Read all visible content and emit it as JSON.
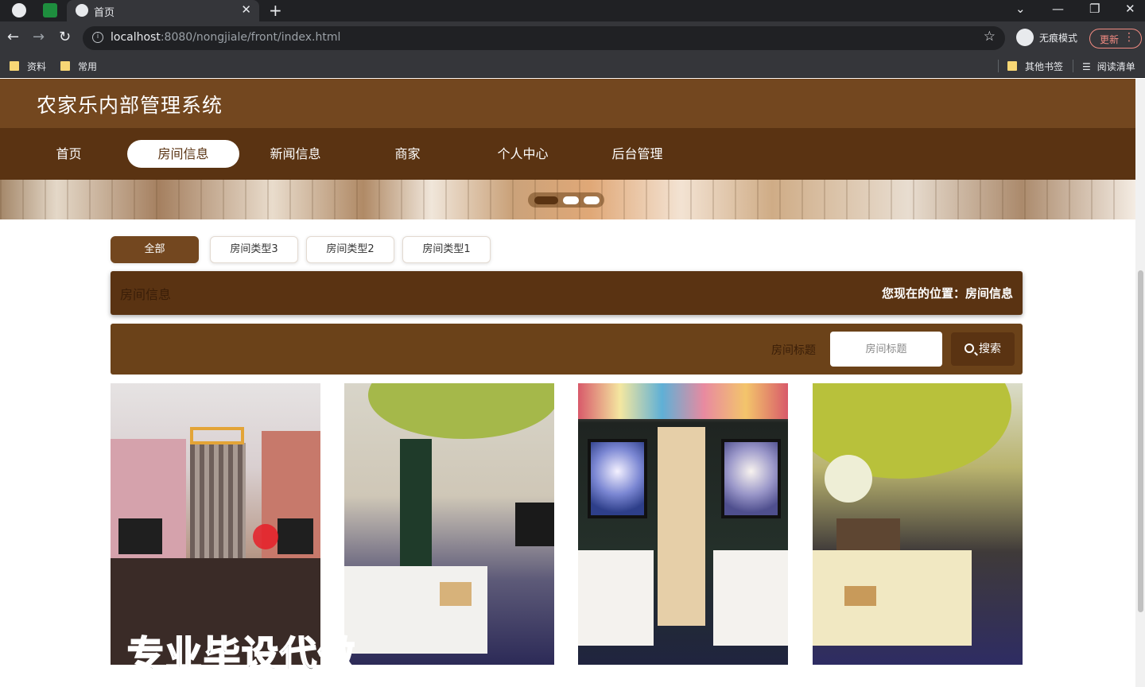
{
  "browser": {
    "tab_title": "首页",
    "url_host": "localhost",
    "url_rest": ":8080/nongjiale/front/index.html",
    "incognito_label": "无痕模式",
    "update_label": "更新",
    "bookmarks": [
      "资料",
      "常用"
    ],
    "bookmarks_right": [
      "其他书签",
      "阅读清单"
    ]
  },
  "site": {
    "title": "农家乐内部管理系统",
    "nav": [
      "首页",
      "房间信息",
      "新闻信息",
      "商家",
      "个人中心",
      "后台管理"
    ],
    "nav_active_index": 1
  },
  "filters": {
    "items": [
      "全部",
      "房间类型3",
      "房间类型2",
      "房间类型1"
    ],
    "active_index": 0
  },
  "crumb": {
    "title": "房间信息",
    "location": "您现在的位置：房间信息"
  },
  "search": {
    "label": "房间标题",
    "placeholder": "房间标题",
    "button": "搜索"
  },
  "rooms": [
    {
      "name": "room-image-1"
    },
    {
      "name": "room-image-2"
    },
    {
      "name": "room-image-3"
    },
    {
      "name": "room-image-4"
    }
  ],
  "watermark": "专业毕设代做",
  "colors": {
    "header": "#73471f",
    "nav": "#5a3312",
    "accent": "#73471f"
  }
}
